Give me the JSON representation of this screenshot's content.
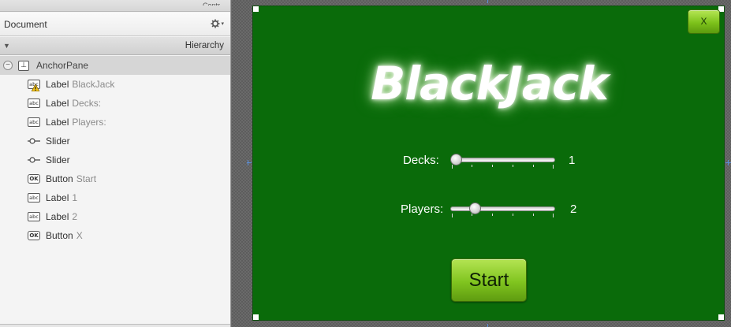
{
  "document_panel": {
    "title": "Document",
    "gear_icon": "gear-icon",
    "hierarchy_label": "Hierarchy"
  },
  "tree": {
    "root": {
      "type": "AnchorPane",
      "text": ""
    },
    "children": [
      {
        "icon": "label-icon",
        "type": "Label",
        "text": "BlackJack",
        "warning": true
      },
      {
        "icon": "label-icon",
        "type": "Label",
        "text": "Decks:"
      },
      {
        "icon": "label-icon",
        "type": "Label",
        "text": "Players:"
      },
      {
        "icon": "slider-icon",
        "type": "Slider",
        "text": ""
      },
      {
        "icon": "slider-icon",
        "type": "Slider",
        "text": ""
      },
      {
        "icon": "button-icon",
        "type": "Button",
        "text": "Start"
      },
      {
        "icon": "label-icon",
        "type": "Label",
        "text": "1"
      },
      {
        "icon": "label-icon",
        "type": "Label",
        "text": "2"
      },
      {
        "icon": "button-icon",
        "type": "Button",
        "text": "X"
      }
    ]
  },
  "icon_glyphs": {
    "label": "abc",
    "button": "OK",
    "anchor": "⊥"
  },
  "game": {
    "title": "BlackJack",
    "close_label": "X",
    "start_label": "Start",
    "decks": {
      "label": "Decks:",
      "value": "1",
      "position": 0.0
    },
    "players": {
      "label": "Players:",
      "value": "2",
      "position": 0.2
    }
  },
  "colors": {
    "felt": "#0a6b0a",
    "button_green": "#80c41f",
    "selection_guides": "#5b8fd8"
  }
}
